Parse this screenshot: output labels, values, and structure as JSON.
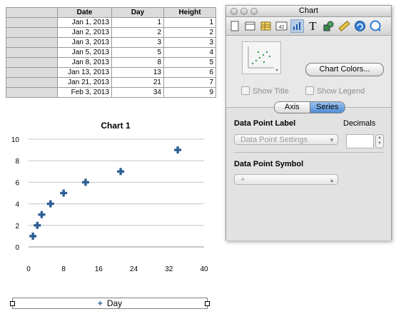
{
  "table": {
    "headers": [
      "Date",
      "Day",
      "Height"
    ],
    "rows": [
      [
        "Jan 1, 2013",
        "1",
        "1"
      ],
      [
        "Jan 2, 2013",
        "2",
        "2"
      ],
      [
        "Jan 3, 2013",
        "3",
        "3"
      ],
      [
        "Jan 5, 2013",
        "5",
        "4"
      ],
      [
        "Jan 8, 2013",
        "8",
        "5"
      ],
      [
        "Jan 13, 2013",
        "13",
        "6"
      ],
      [
        "Jan 21, 2013",
        "21",
        "7"
      ],
      [
        "Feb 3, 2013",
        "34",
        "9"
      ]
    ]
  },
  "chart_data": {
    "type": "scatter",
    "title": "Chart 1",
    "xlabel": "",
    "ylabel": "",
    "xlim": [
      0,
      40
    ],
    "ylim": [
      0,
      10
    ],
    "x_ticks": [
      0,
      8,
      16,
      24,
      32,
      40
    ],
    "y_ticks": [
      0,
      2,
      4,
      6,
      8,
      10
    ],
    "grid": "horizontal",
    "marker": "+",
    "color": "#2d5f93",
    "series": [
      {
        "name": "Day",
        "x": [
          1,
          2,
          3,
          5,
          8,
          13,
          21,
          34
        ],
        "y": [
          1,
          2,
          3,
          4,
          5,
          6,
          7,
          9
        ]
      }
    ],
    "legend_position": "bottom"
  },
  "legend": {
    "symbol": "+",
    "label": "Day"
  },
  "inspector": {
    "title": "Chart",
    "toolbar_icons": [
      "document-icon",
      "layout-icon",
      "table-icon",
      "cell-format-icon",
      "chart-icon",
      "text-icon",
      "graphic-icon",
      "metrics-icon",
      "link-icon",
      "quicktime-icon"
    ],
    "toolbar_selected": "chart-icon",
    "chart_colors_label": "Chart Colors...",
    "show_title_label": "Show Title",
    "show_legend_label": "Show Legend",
    "tabs": [
      "Axis",
      "Series"
    ],
    "active_tab": "Series",
    "data_point_label_heading": "Data Point Label",
    "decimals_label": "Decimals",
    "data_point_settings": "Data Point Settings",
    "data_point_symbol_heading": "Data Point Symbol",
    "symbol_value": "+"
  }
}
